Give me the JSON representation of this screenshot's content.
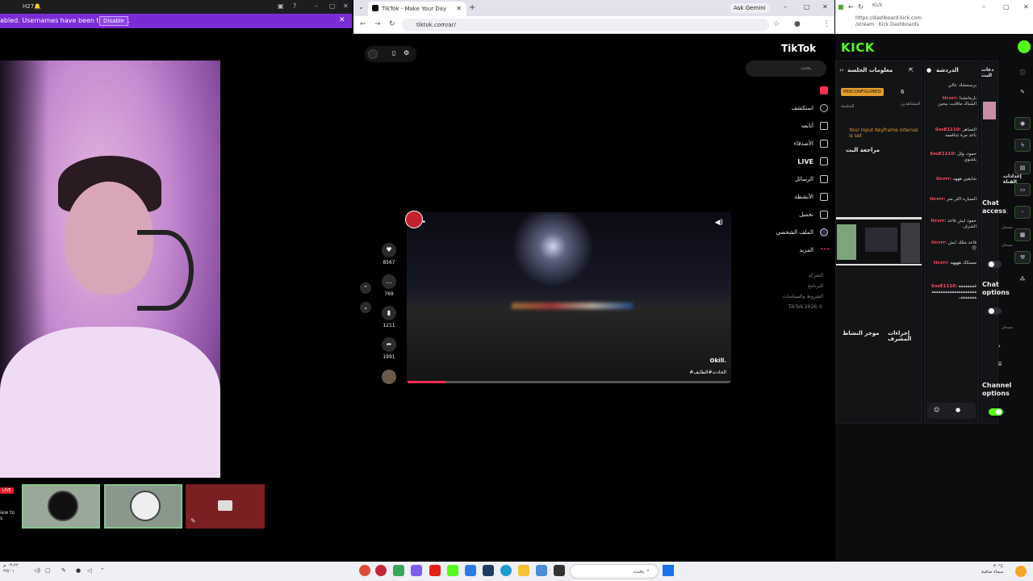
{
  "left_window": {
    "title": "H27🔔",
    "banner_text": "abled. Usernames have been truncated.",
    "banner_button": "Disable",
    "live_badge": "LIVE",
    "live_sub": "iew to s."
  },
  "browser": {
    "tab_title": "TikTok - Make Your Day",
    "gemini_label": "Ask Gemini",
    "url": "tiktok.com/ar/"
  },
  "tiktok": {
    "logo": "TikTok",
    "search_placeholder": "بحث",
    "menu": [
      {
        "label": "",
        "icon": "home-icon"
      },
      {
        "label": "استكشف",
        "icon": "compass-icon"
      },
      {
        "label": "أتابعه",
        "icon": "user-follow-icon"
      },
      {
        "label": "الأصدقاء",
        "icon": "friends-icon"
      },
      {
        "label": "LIVE",
        "icon": "live-icon"
      },
      {
        "label": "الرسائل",
        "icon": "send-icon"
      },
      {
        "label": "الأنشطة",
        "icon": "inbox-icon"
      },
      {
        "label": "تحميل",
        "icon": "upload-icon"
      },
      {
        "label": "الملف الشخصي",
        "icon": "profile-icon"
      },
      {
        "label": "المزيد",
        "icon": "more-icon"
      }
    ],
    "footer": [
      "الشركة",
      "البرنامج",
      "الشروط والسياسات",
      "TikTok 2026 ©"
    ],
    "video_user": "Okill.",
    "video_caption": "#الحادث#الطايف",
    "likes": "8567",
    "comments": "769",
    "saves": "1211",
    "shares": "1991",
    "progress": 0.12
  },
  "kick": {
    "tab_title": "Kick",
    "url_line1": "https://dashboard.kick.com",
    "url_line2": "/stream · Kick Dashboards",
    "logo": "KICK",
    "panels": {
      "session": "معلومات الجلسة",
      "chat": "الدردشة",
      "live": "دعات البث",
      "access": "إعدادات القناة"
    },
    "session_status": "MISCONFIGURED",
    "session_status_label": "الجلسة",
    "viewers": "6",
    "viewers_label": "المشاهدين",
    "keyframe_warning": "Your Input Keyframe interval is set",
    "review_label": "مراجعة البث",
    "shortcuts_label": "موجز النشاط",
    "mod_actions_label": "إجراءات المشرف",
    "chat_messages": [
      {
        "user": "",
        "text": "يرسحشك عالي"
      },
      {
        "user": "ticvrr:",
        "text": "بارماتشدا الشباك ماقايت بيحين"
      },
      {
        "user": "SosE1110:",
        "text": "النساهر باعد مرة تتنافسه"
      },
      {
        "user": "SosE1110:",
        "text": "حمود، ولل بلشوي"
      },
      {
        "user": "ticvrr:",
        "text": "شابقين هههه"
      },
      {
        "user": "ticvrr:",
        "text": "السياره اكثر متر"
      },
      {
        "user": "ticvrr:",
        "text": "حمود ايش قاعد الشرف"
      },
      {
        "user": "ticvrr:",
        "text": "قاعد مثلك ايش 😊"
      },
      {
        "user": "ticvrr:",
        "text": "مستكك ههههه"
      },
      {
        "user": "SosE1110:",
        "text": "ففففففففففففففففففففففففففففففففففف"
      }
    ],
    "chat_access": "Chat access",
    "chat_options": "Chat options",
    "channel_options": "Channel options",
    "opt_small": "مسجل"
  },
  "taskbar": {
    "left_clock": "٠٣:٢٢ م\n٢٥/٠١",
    "search": "بحث",
    "right_clock": "٣٠°C\nسماء صافية"
  }
}
